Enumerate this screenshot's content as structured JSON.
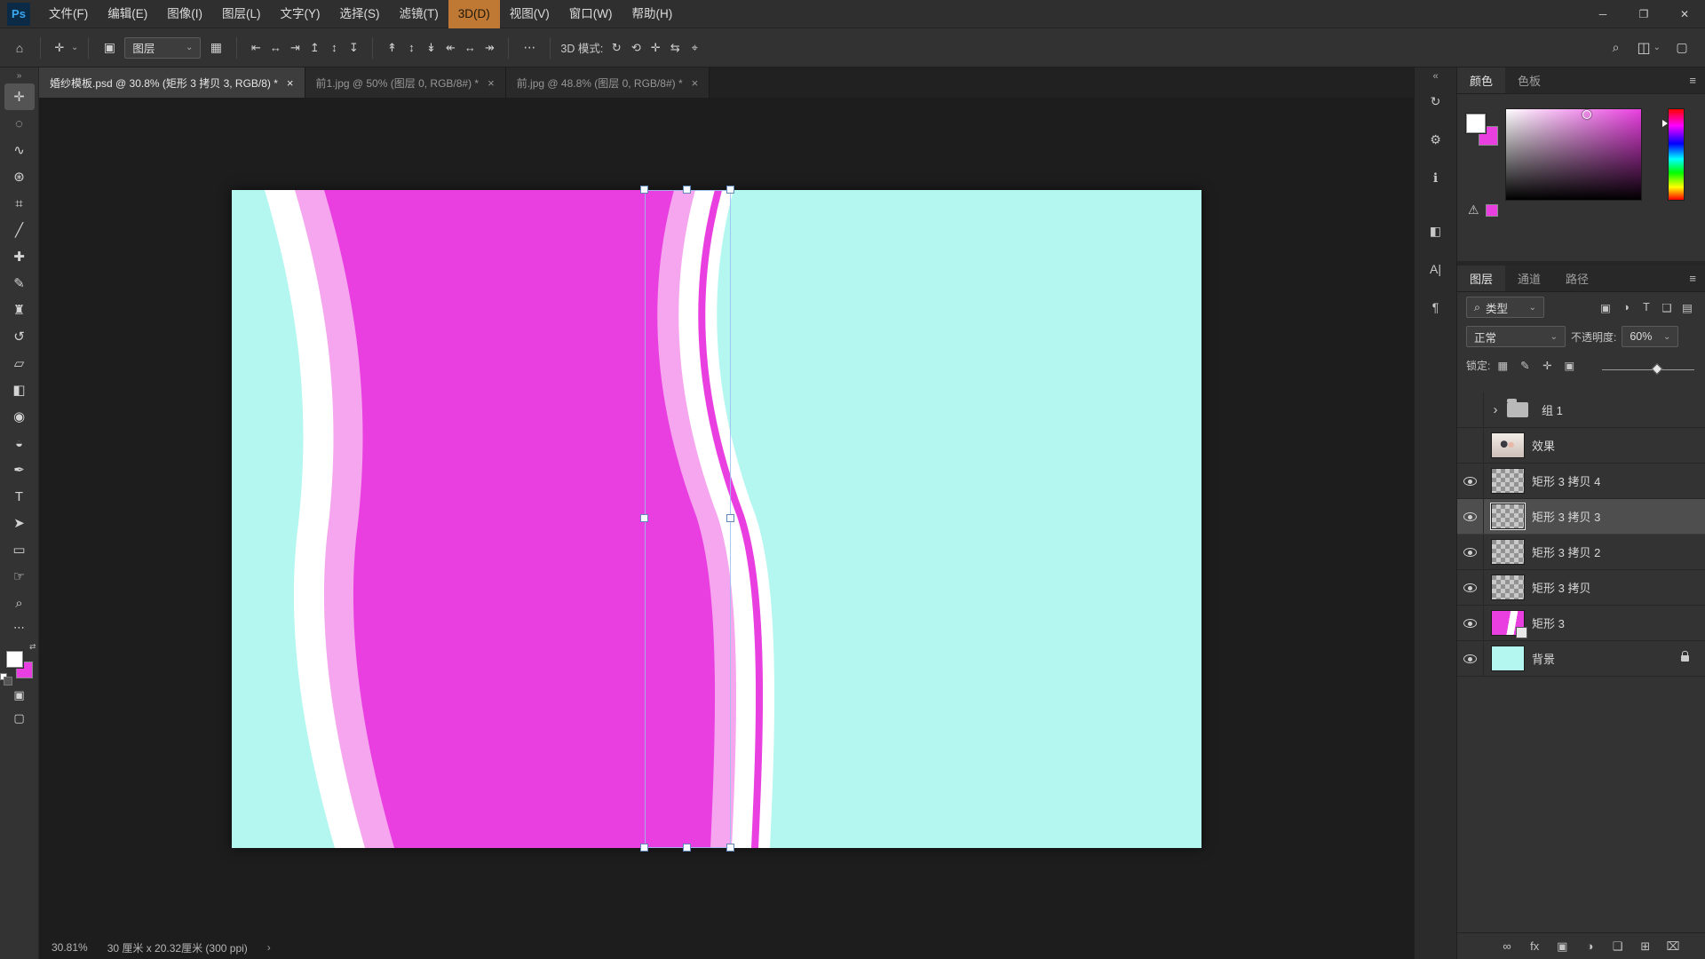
{
  "colors": {
    "cyan": "#b4f6f0",
    "magenta": "#e93fe0",
    "pink": "#f5a6ee",
    "accent": "#8fbef5"
  },
  "menu_bar": {
    "logo": "Ps",
    "items": [
      {
        "label": "文件(F)",
        "highlighted": false
      },
      {
        "label": "编辑(E)",
        "highlighted": false
      },
      {
        "label": "图像(I)",
        "highlighted": false
      },
      {
        "label": "图层(L)",
        "highlighted": false
      },
      {
        "label": "文字(Y)",
        "highlighted": false
      },
      {
        "label": "选择(S)",
        "highlighted": false
      },
      {
        "label": "滤镜(T)",
        "highlighted": false
      },
      {
        "label": "3D(D)",
        "highlighted": true
      },
      {
        "label": "视图(V)",
        "highlighted": false
      },
      {
        "label": "窗口(W)",
        "highlighted": false
      },
      {
        "label": "帮助(H)",
        "highlighted": false
      }
    ],
    "window_controls": [
      {
        "name": "minimize-button",
        "glyph": "─"
      },
      {
        "name": "restore-button",
        "glyph": "❐"
      },
      {
        "name": "close-button",
        "glyph": "✕"
      }
    ]
  },
  "options_bar": {
    "home_icon": "⌂",
    "tool_icon": "✛",
    "tool_dropdown_icon": "⌄",
    "autoselect_icon": "▣",
    "target_select_label": "图层",
    "select_chevron": "⌄",
    "transform_toggle_icon": "▦",
    "align_icons": [
      {
        "name": "align-left-icon",
        "glyph": "⇤"
      },
      {
        "name": "align-center-h-icon",
        "glyph": "↔"
      },
      {
        "name": "align-right-icon",
        "glyph": "⇥"
      },
      {
        "name": "align-top-icon",
        "glyph": "↥"
      },
      {
        "name": "align-center-v-icon",
        "glyph": "↕"
      },
      {
        "name": "align-bottom-icon",
        "glyph": "↧"
      }
    ],
    "distribute_icons": [
      {
        "name": "distribute-top-icon",
        "glyph": "↟"
      },
      {
        "name": "distribute-v-icon",
        "glyph": "↕"
      },
      {
        "name": "distribute-bottom-icon",
        "glyph": "↡"
      },
      {
        "name": "distribute-left-icon",
        "glyph": "↞"
      },
      {
        "name": "distribute-h-icon",
        "glyph": "↔"
      },
      {
        "name": "distribute-right-icon",
        "glyph": "↠"
      }
    ],
    "more_icon": "⋯",
    "mode_label": "3D 模式:",
    "mode_icons": [
      {
        "name": "3d-orbit-icon",
        "glyph": "↻"
      },
      {
        "name": "3d-roll-icon",
        "glyph": "⟲"
      },
      {
        "name": "3d-pan-icon",
        "glyph": "✛"
      },
      {
        "name": "3d-slide-icon",
        "glyph": "⇆"
      },
      {
        "name": "3d-scale-icon",
        "glyph": "⌖"
      }
    ],
    "search_icon": "⌕",
    "workspace_icon": "◫",
    "workspace_chevron": "⌄",
    "dock_icon": "▢"
  },
  "document_tabs": [
    {
      "title": "婚纱模板.psd @ 30.8% (矩形 3 拷贝 3, RGB/8) *",
      "close": "×",
      "active": true
    },
    {
      "title": "前1.jpg @ 50% (图层 0, RGB/8#) *",
      "close": "×",
      "active": false
    },
    {
      "title": "前.jpg @ 48.8% (图层 0, RGB/8#) *",
      "close": "×",
      "active": false
    }
  ],
  "toolbar": {
    "collapse_icon": "»",
    "tools": [
      {
        "name": "move-tool",
        "glyph": "✛",
        "active": true
      },
      {
        "name": "marquee-tool",
        "glyph": "◌",
        "active": false
      },
      {
        "name": "lasso-tool",
        "glyph": "∿",
        "active": false
      },
      {
        "name": "quick-selection-tool",
        "glyph": "⊛",
        "active": false
      },
      {
        "name": "crop-tool",
        "glyph": "⌗",
        "active": false
      },
      {
        "name": "eyedropper-tool",
        "glyph": "╱",
        "active": false
      },
      {
        "name": "healing-brush-tool",
        "glyph": "✚",
        "active": false
      },
      {
        "name": "brush-tool",
        "glyph": "✎",
        "active": false
      },
      {
        "name": "clone-stamp-tool",
        "glyph": "♜",
        "active": false
      },
      {
        "name": "history-brush-tool",
        "glyph": "↺",
        "active": false
      },
      {
        "name": "eraser-tool",
        "glyph": "▱",
        "active": false
      },
      {
        "name": "gradient-tool",
        "glyph": "◧",
        "active": false
      },
      {
        "name": "blur-tool",
        "glyph": "◉",
        "active": false
      },
      {
        "name": "dodge-tool",
        "glyph": "◒",
        "active": false
      },
      {
        "name": "pen-tool",
        "glyph": "✒",
        "active": false
      },
      {
        "name": "type-tool",
        "glyph": "T",
        "active": false
      },
      {
        "name": "path-selection-tool",
        "glyph": "➤",
        "active": false
      },
      {
        "name": "shape-tool",
        "glyph": "▭",
        "active": false
      },
      {
        "name": "hand-tool",
        "glyph": "☞",
        "active": false
      },
      {
        "name": "zoom-tool",
        "glyph": "⌕",
        "active": false
      }
    ],
    "more_icon": "⋯",
    "swap_icon": "⇄",
    "quickmask_icon": "▣",
    "screenmode_icon": "▢"
  },
  "canvas": {
    "status": {
      "zoom": "30.81%",
      "doc_info": "30 厘米 x 20.32厘米 (300 ppi)",
      "chevron": "›"
    }
  },
  "dock_strip": {
    "collapse_icon": "«",
    "icons": [
      {
        "name": "history-panel-icon",
        "glyph": "↻"
      },
      {
        "name": "properties-panel-icon",
        "glyph": "⚙"
      },
      {
        "name": "info-panel-icon",
        "glyph": "ℹ"
      },
      {
        "name": "adjustments-panel-icon",
        "glyph": "◧"
      },
      {
        "name": "character-panel-icon",
        "glyph": "A|"
      },
      {
        "name": "paragraph-panel-icon",
        "glyph": "¶"
      }
    ]
  },
  "color_panel": {
    "tabs": [
      {
        "label": "颜色",
        "active": true
      },
      {
        "label": "色板",
        "active": false
      }
    ],
    "menu_icon": "≡",
    "warning_icon": "⚠"
  },
  "layers_panel": {
    "tabs": [
      {
        "label": "图层",
        "active": true
      },
      {
        "label": "通道",
        "active": false
      },
      {
        "label": "路径",
        "active": false
      }
    ],
    "menu_icon": "≡",
    "search_icon": "⌕",
    "filter_label": "类型",
    "filter_chevron": "⌄",
    "filter_icons": [
      {
        "name": "filter-pixel-layers-icon",
        "glyph": "▣"
      },
      {
        "name": "filter-adjustment-layers-icon",
        "glyph": "◑"
      },
      {
        "name": "filter-type-layers-icon",
        "glyph": "T"
      },
      {
        "name": "filter-shape-layers-icon",
        "glyph": "❑"
      },
      {
        "name": "filter-smart-objects-icon",
        "glyph": "▤"
      }
    ],
    "blend_mode": "正常",
    "blend_chevron": "⌄",
    "opacity_label": "不透明度:",
    "opacity_value": "60%",
    "opacity_percent": 60,
    "opacity_chevron": "⌄",
    "lock_label": "锁定:",
    "lock_icons": [
      {
        "name": "lock-transparency-icon",
        "glyph": "▦"
      },
      {
        "name": "lock-pixels-icon",
        "glyph": "✎"
      },
      {
        "name": "lock-position-icon",
        "glyph": "✛"
      },
      {
        "name": "lock-artboard-icon",
        "glyph": "▣"
      }
    ],
    "layers": [
      {
        "name": "组 1",
        "thumb": "group",
        "eye": false,
        "selected": false,
        "locked": false,
        "is_group": true
      },
      {
        "name": "效果",
        "thumb": "photo",
        "eye": false,
        "selected": false,
        "locked": false,
        "is_group": false
      },
      {
        "name": "矩形 3 拷贝 4",
        "thumb": "checker",
        "eye": true,
        "selected": false,
        "locked": false,
        "is_group": false
      },
      {
        "name": "矩形 3 拷贝 3",
        "thumb": "checker",
        "eye": true,
        "selected": true,
        "locked": false,
        "is_group": false
      },
      {
        "name": "矩形 3 拷贝 2",
        "thumb": "checker",
        "eye": true,
        "selected": false,
        "locked": false,
        "is_group": false
      },
      {
        "name": "矩形 3 拷贝",
        "thumb": "checker",
        "eye": true,
        "selected": false,
        "locked": false,
        "is_group": false
      },
      {
        "name": "矩形 3",
        "thumb": "shape",
        "eye": true,
        "selected": false,
        "locked": false,
        "is_group": false
      },
      {
        "name": "背景",
        "thumb": "bg",
        "eye": true,
        "selected": false,
        "locked": true,
        "is_group": false
      }
    ],
    "footer_icons": [
      {
        "name": "link-layers-icon",
        "glyph": "∞"
      },
      {
        "name": "layer-style-icon",
        "glyph": "fx"
      },
      {
        "name": "layer-mask-icon",
        "glyph": "▣"
      },
      {
        "name": "adjustment-layer-icon",
        "glyph": "◑"
      },
      {
        "name": "new-group-icon",
        "glyph": "❑"
      },
      {
        "name": "new-layer-icon",
        "glyph": "⊞"
      },
      {
        "name": "delete-layer-icon",
        "glyph": "⌧"
      }
    ]
  }
}
